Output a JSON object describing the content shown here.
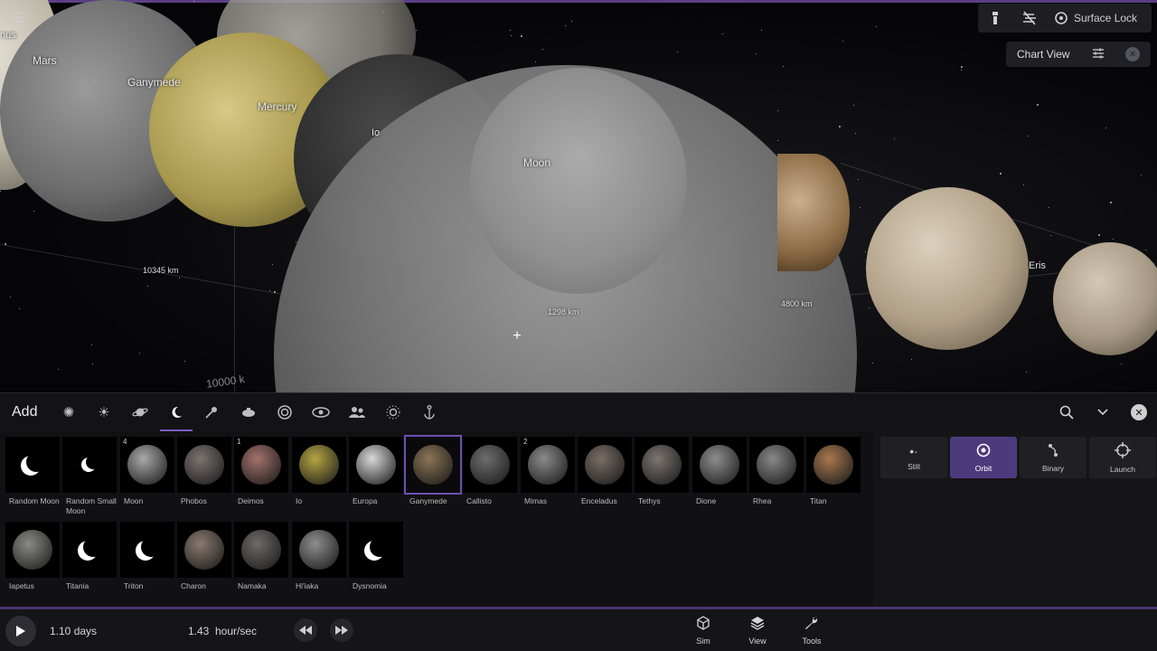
{
  "viewport": {
    "labels": {
      "venus": "nus",
      "mars": "Mars",
      "ganymede": "Ganymede",
      "mercury": "Mercury",
      "io": "Io",
      "moon": "Moon",
      "eris": "Eris"
    },
    "distances": {
      "d1": "10345 km",
      "d2": "1298 km",
      "d3": "4800 km",
      "d4": "10000 k"
    },
    "top_right": {
      "surface_lock_label": "Surface Lock",
      "chart_view_label": "Chart View"
    }
  },
  "panel": {
    "title": "Add",
    "category_icons": [
      "galaxy-icon",
      "star-icon",
      "planet-icon",
      "moon-icon",
      "asteroid-icon",
      "spacecraft-icon",
      "swirl-icon",
      "eye-icon",
      "people-icon",
      "sun-small-icon",
      "anchor-icon"
    ],
    "active_category": "moon-icon",
    "items": [
      {
        "name": "Random Moon",
        "kind": "crescent"
      },
      {
        "name": "Random Small Moon",
        "kind": "crescent-sm"
      },
      {
        "name": "Moon",
        "kind": "ball",
        "badge": "4",
        "color": "#a9a9a9"
      },
      {
        "name": "Phobos",
        "kind": "ball",
        "color": "#7c7470"
      },
      {
        "name": "Deimos",
        "kind": "ball",
        "badge": "1",
        "color": "#a3726c"
      },
      {
        "name": "Io",
        "kind": "ball",
        "color": "#b6a542"
      },
      {
        "name": "Europa",
        "kind": "ball",
        "color": "#d8d8d8"
      },
      {
        "name": "Ganymede",
        "kind": "ball",
        "color": "#8b7456",
        "selected": true
      },
      {
        "name": "Callisto",
        "kind": "ball",
        "color": "#6d6d6d"
      },
      {
        "name": "Mimas",
        "kind": "ball",
        "badge": "2",
        "color": "#8a8a8a"
      },
      {
        "name": "Enceladus",
        "kind": "ball",
        "color": "#7a6e66"
      },
      {
        "name": "Tethys",
        "kind": "ball",
        "color": "#7c7570"
      },
      {
        "name": "Dione",
        "kind": "ball",
        "color": "#8e8e8e"
      },
      {
        "name": "Rhea",
        "kind": "ball",
        "color": "#898989"
      },
      {
        "name": "Titan",
        "kind": "ball",
        "color": "#a8784e"
      },
      {
        "name": "Iapetus",
        "kind": "ball",
        "color": "#8a8a84"
      },
      {
        "name": "Titania",
        "kind": "crescent"
      },
      {
        "name": "Triton",
        "kind": "crescent"
      },
      {
        "name": "Charon",
        "kind": "ball",
        "color": "#8a7a70"
      },
      {
        "name": "Namaka",
        "kind": "ball",
        "color": "#6e6a68"
      },
      {
        "name": "Hi'iaka",
        "kind": "ball",
        "color": "#8e8e8e"
      },
      {
        "name": "Dysnomia",
        "kind": "crescent"
      }
    ],
    "modes": [
      {
        "label": "Still",
        "icon": "dot-icon"
      },
      {
        "label": "Orbit",
        "icon": "orbit-icon",
        "active": true
      },
      {
        "label": "Binary",
        "icon": "binary-icon"
      },
      {
        "label": "Launch",
        "icon": "launch-icon"
      }
    ]
  },
  "bottom_bar": {
    "elapsed": "1.10 days",
    "rate_value": "1.43",
    "rate_unit": "hour/sec",
    "sim_label": "Sim",
    "view_label": "View",
    "tools_label": "Tools"
  },
  "colors": {
    "accent": "#6d4fb0",
    "accent_dark": "#4d3a7d"
  }
}
